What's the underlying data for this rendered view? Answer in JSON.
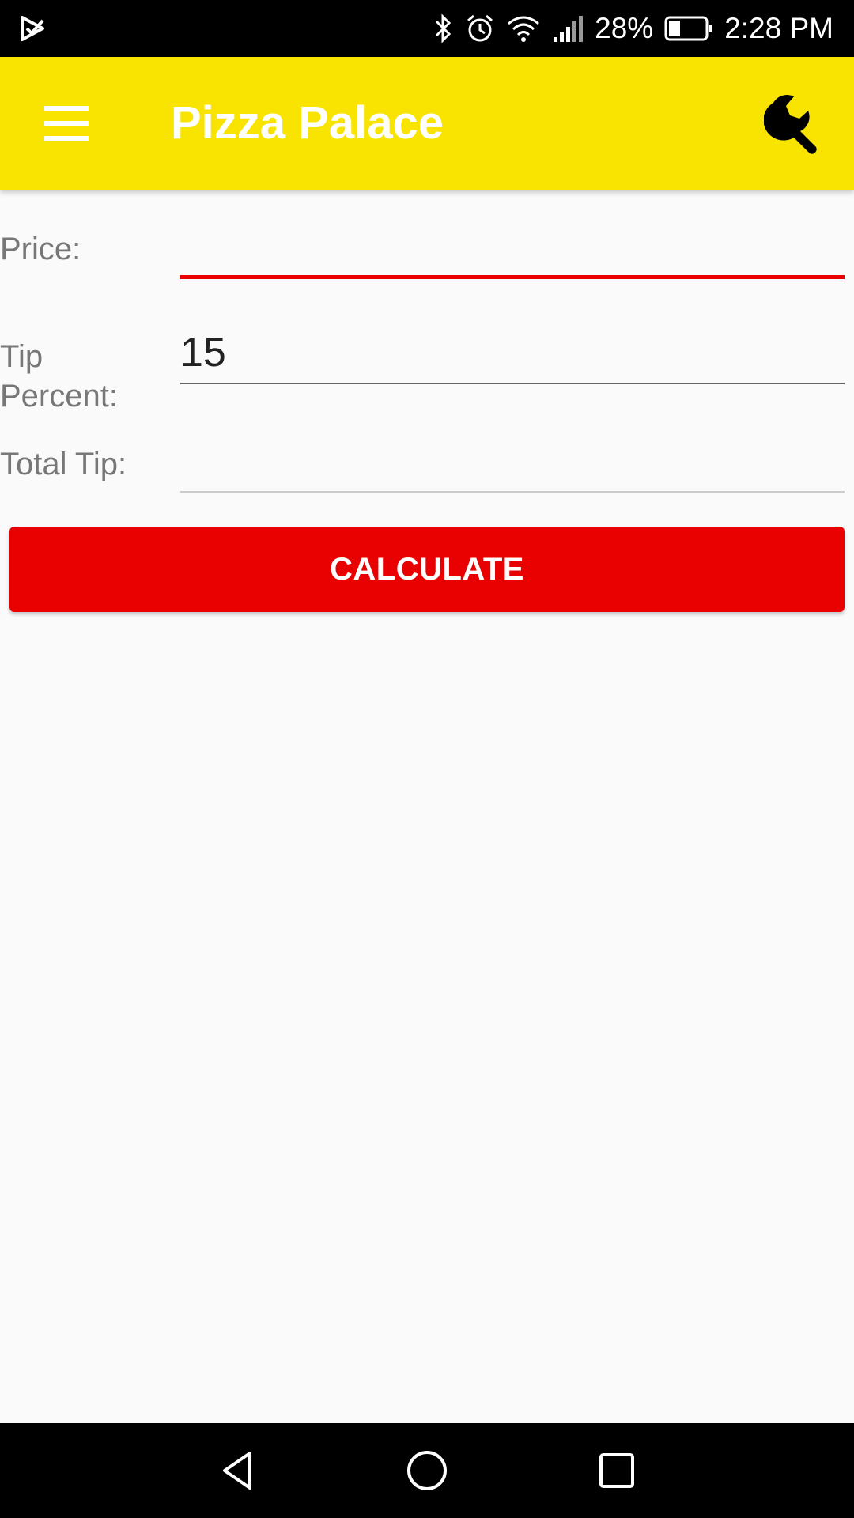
{
  "status_bar": {
    "battery_percent": "28%",
    "time": "2:28 PM",
    "icons": [
      "play-store-notification-icon",
      "bluetooth-icon",
      "alarm-icon",
      "wifi-icon",
      "signal-icon",
      "battery-icon"
    ]
  },
  "toolbar": {
    "title": "Pizza Palace",
    "background_color": "#f8e400",
    "menu_icon": "hamburger-menu-icon",
    "settings_icon": "wrench-icon"
  },
  "form": {
    "price_label": "Price:",
    "price_value": "",
    "tip_percent_label_line1": "Tip",
    "tip_percent_label_line2": "Percent:",
    "tip_percent_value": "15",
    "total_tip_label": "Total Tip:",
    "total_tip_value": ""
  },
  "calculate_button": {
    "label": "CALCULATE",
    "color": "#e90000"
  },
  "nav_bar": {
    "icons": [
      "back-icon",
      "home-icon",
      "recents-icon"
    ]
  }
}
